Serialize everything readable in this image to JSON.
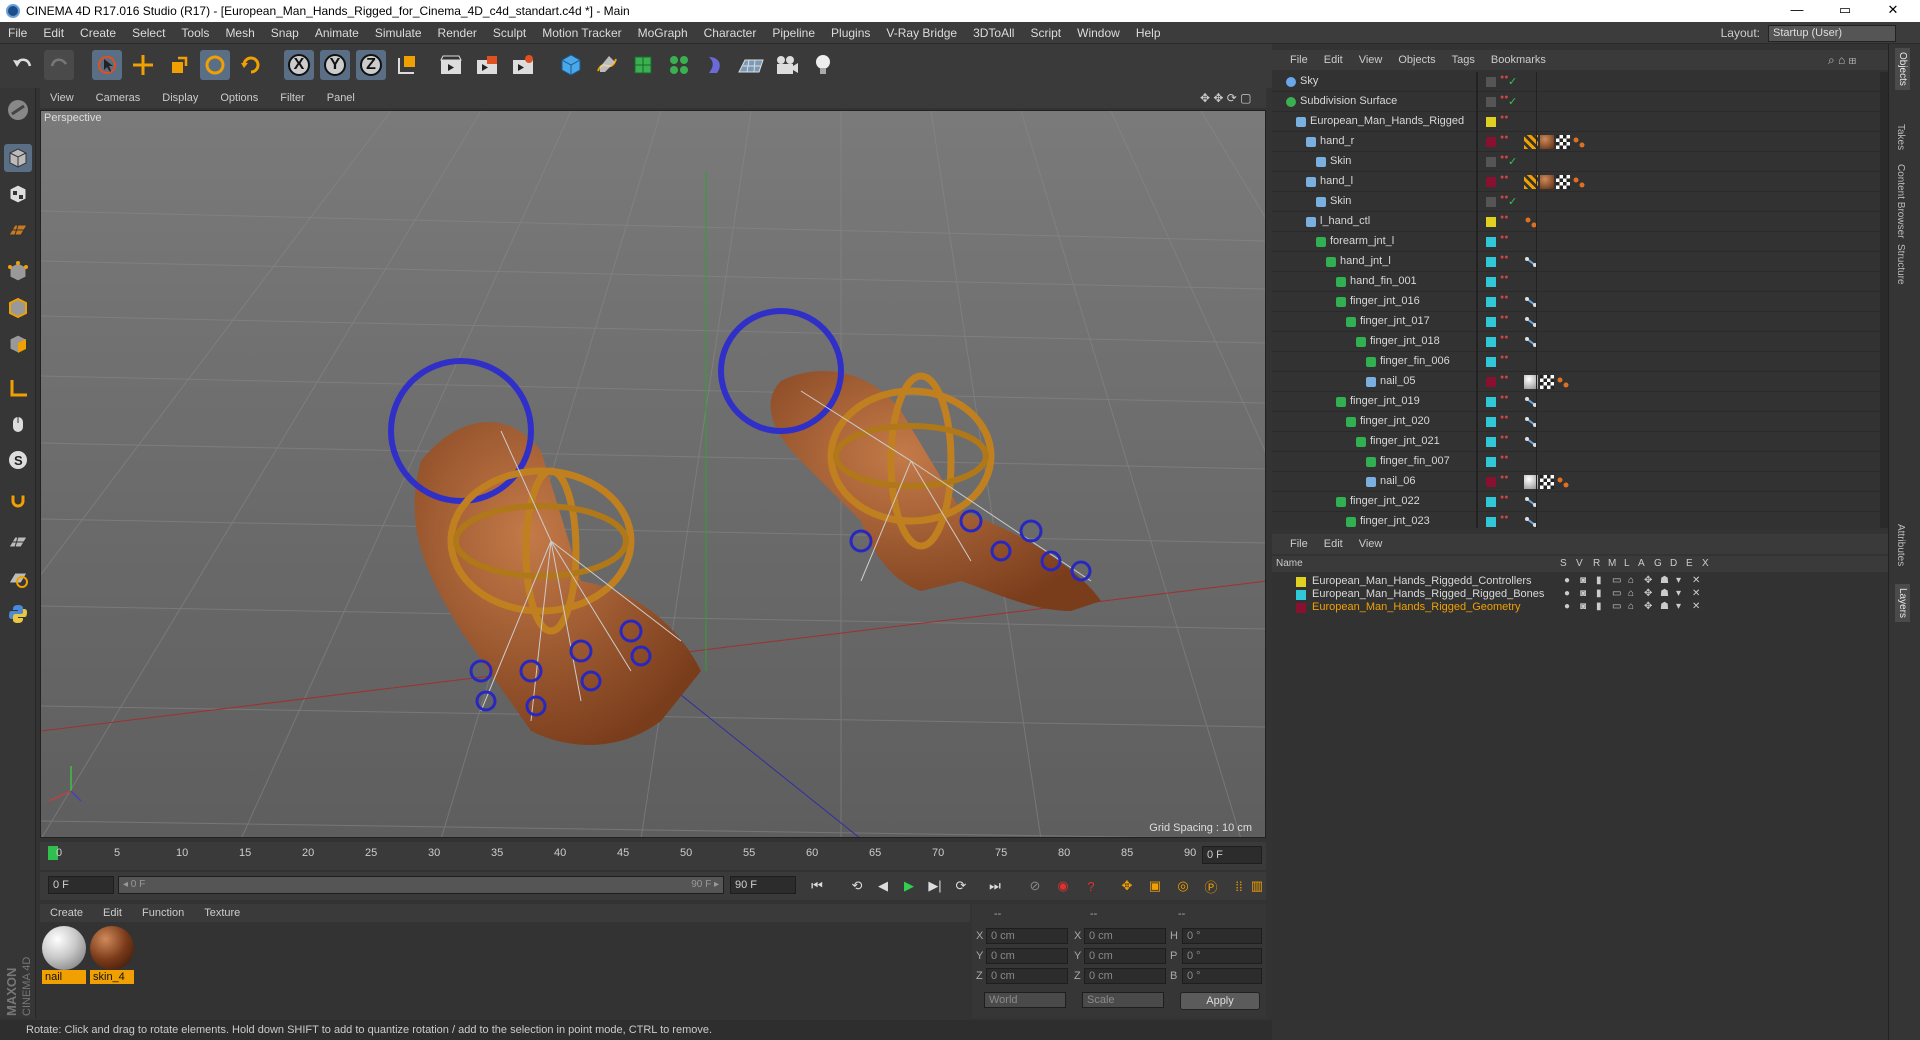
{
  "titlebar": {
    "title": "CINEMA 4D R17.016 Studio (R17) - [European_Man_Hands_Rigged_for_Cinema_4D_c4d_standart.c4d *] - Main",
    "minimize": "—",
    "maximize": "▭",
    "close": "✕"
  },
  "menubar": {
    "items": [
      "File",
      "Edit",
      "Create",
      "Select",
      "Tools",
      "Mesh",
      "Snap",
      "Animate",
      "Simulate",
      "Render",
      "Sculpt",
      "Motion Tracker",
      "MoGraph",
      "Character",
      "Pipeline",
      "Plugins",
      "V-Ray Bridge",
      "3DToAll",
      "Script",
      "Window",
      "Help"
    ],
    "layout_label": "Layout:",
    "layout_value": "Startup (User)"
  },
  "toolbar": {
    "x_label": "X",
    "y_label": "Y",
    "z_label": "Z"
  },
  "viewport": {
    "menu": [
      "View",
      "Cameras",
      "Display",
      "Options",
      "Filter",
      "Panel"
    ],
    "camera_label": "Perspective",
    "grid_spacing": "Grid Spacing : 10 cm"
  },
  "timeline": {
    "ticks": [
      "0",
      "5",
      "10",
      "15",
      "20",
      "25",
      "30",
      "35",
      "40",
      "45",
      "50",
      "55",
      "60",
      "65",
      "70",
      "75",
      "80",
      "85",
      "90"
    ],
    "current_frame_field": "0 F",
    "start_field": "0 F",
    "range_start": "◂ 0 F",
    "range_end": "90 F ▸",
    "end_field": "90 F"
  },
  "materials": {
    "menu": [
      "Create",
      "Edit",
      "Function",
      "Texture"
    ],
    "items": [
      {
        "name": "nail",
        "color": "#c8c8c8"
      },
      {
        "name": "skin_4",
        "color": "#7a3a1a"
      }
    ]
  },
  "coordinates": {
    "header": [
      "--",
      "--",
      "--"
    ],
    "rows": [
      {
        "a": "X",
        "av": "0 cm",
        "b": "X",
        "bv": "0 cm",
        "c": "H",
        "cv": "0 °"
      },
      {
        "a": "Y",
        "av": "0 cm",
        "b": "Y",
        "bv": "0 cm",
        "c": "P",
        "cv": "0 °"
      },
      {
        "a": "Z",
        "av": "0 cm",
        "b": "Z",
        "bv": "0 cm",
        "c": "B",
        "cv": "0 °"
      }
    ],
    "mode1": "World",
    "mode2": "Scale",
    "apply": "Apply"
  },
  "status": {
    "text": "Rotate: Click and drag to rotate elements. Hold down SHIFT to add to quantize rotation / add to the selection in point mode, CTRL to remove."
  },
  "objects": {
    "menu": [
      "File",
      "Edit",
      "View",
      "Objects",
      "Tags",
      "Bookmarks"
    ],
    "rows": [
      {
        "name": "Sky",
        "color": "#555555"
      },
      {
        "name": "Subdivision Surface",
        "color": "#555555"
      },
      {
        "name": "European_Man_Hands_Rigged",
        "color": "#e0d020"
      },
      {
        "name": "hand_r",
        "color": "#8a1030"
      },
      {
        "name": "Skin",
        "color": "#555555"
      },
      {
        "name": "hand_l",
        "color": "#8a1030"
      },
      {
        "name": "Skin",
        "color": "#555555"
      },
      {
        "name": "l_hand_ctl",
        "color": "#e0d020"
      },
      {
        "name": "forearm_jnt_l",
        "color": "#30c8d8"
      },
      {
        "name": "hand_jnt_l",
        "color": "#30c8d8"
      },
      {
        "name": "hand_fin_001",
        "color": "#30c8d8"
      },
      {
        "name": "finger_jnt_016",
        "color": "#30c8d8"
      },
      {
        "name": "finger_jnt_017",
        "color": "#30c8d8"
      },
      {
        "name": "finger_jnt_018",
        "color": "#30c8d8"
      },
      {
        "name": "finger_fin_006",
        "color": "#30c8d8"
      },
      {
        "name": "nail_05",
        "color": "#8a1030"
      },
      {
        "name": "finger_jnt_019",
        "color": "#30c8d8"
      },
      {
        "name": "finger_jnt_020",
        "color": "#30c8d8"
      },
      {
        "name": "finger_jnt_021",
        "color": "#30c8d8"
      },
      {
        "name": "finger_fin_007",
        "color": "#30c8d8"
      },
      {
        "name": "nail_06",
        "color": "#8a1030"
      },
      {
        "name": "finger_jnt_022",
        "color": "#30c8d8"
      },
      {
        "name": "finger_jnt_023",
        "color": "#30c8d8"
      }
    ]
  },
  "layers": {
    "menu": [
      "File",
      "Edit",
      "View"
    ],
    "header_name": "Name",
    "header_cols": [
      "S",
      "V",
      "R",
      "M",
      "L",
      "A",
      "G",
      "D",
      "E",
      "X"
    ],
    "rows": [
      {
        "name": "European_Man_Hands_Riggedd_Controllers",
        "color": "#e0d020",
        "text_color": "#d8d8d8"
      },
      {
        "name": "European_Man_Hands_Rigged_Rigged_Bones",
        "color": "#30c8d8",
        "text_color": "#d8d8d8"
      },
      {
        "name": "European_Man_Hands_Rigged_Geometry",
        "color": "#8a1030",
        "text_color": "#f0a000"
      }
    ]
  },
  "right_tabs": [
    "Objects",
    "Takes",
    "Content Browser",
    "Structure",
    "Attributes",
    "Layers"
  ],
  "brand": {
    "maxon": "MAXON",
    "product": "CINEMA 4D"
  }
}
